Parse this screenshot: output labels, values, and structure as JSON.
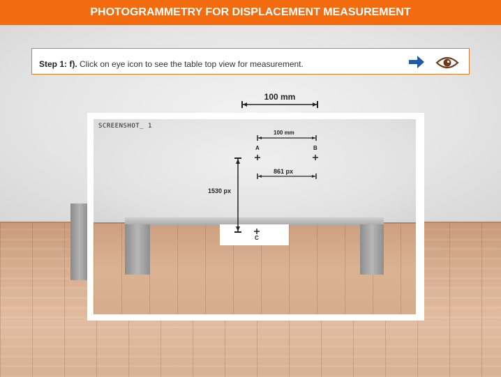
{
  "header": {
    "title": "PHOTOGRAMMETRY FOR DISPLACEMENT MEASUREMENT"
  },
  "instruction": {
    "step": "Step 1: f).",
    "text": "Click on eye icon to see the table top view for measurement."
  },
  "icons": {
    "next": "arrow-right-icon",
    "view": "eye-icon"
  },
  "colors": {
    "header": "#f26b0f",
    "arrow": "#1f5aa8",
    "eye": "#6b3a1a",
    "border": "#e07a2e"
  },
  "measure": {
    "reference_label": "100 mm",
    "screenshot_label": "SCREENSHOT_ 1",
    "small_ref_label": "100 mm",
    "point_a": "A",
    "point_b": "B",
    "point_c": "C",
    "horizontal_px": "861 px",
    "vertical_px": "1530 px"
  }
}
